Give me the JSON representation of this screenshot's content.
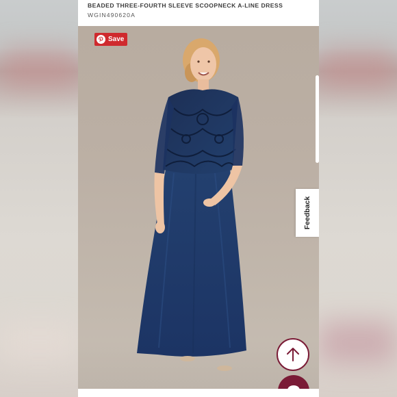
{
  "product": {
    "title": "BEADED THREE-FOURTH SLEEVE SCOOPNECK A-LINE DRESS",
    "sku": "WGIN490620A"
  },
  "pinterest": {
    "save_label": "Save",
    "icon": "pinterest-icon",
    "color": "#cf2a2e"
  },
  "feedback": {
    "label": "Feedback"
  },
  "buttons": {
    "back_to_top_icon": "arrow-up-icon",
    "chat_icon": "chat-bubble-icon",
    "accent": "#7a1b36"
  },
  "image": {
    "subject": "woman wearing navy beaded A-line gown",
    "dress_color": "#1f3561"
  }
}
